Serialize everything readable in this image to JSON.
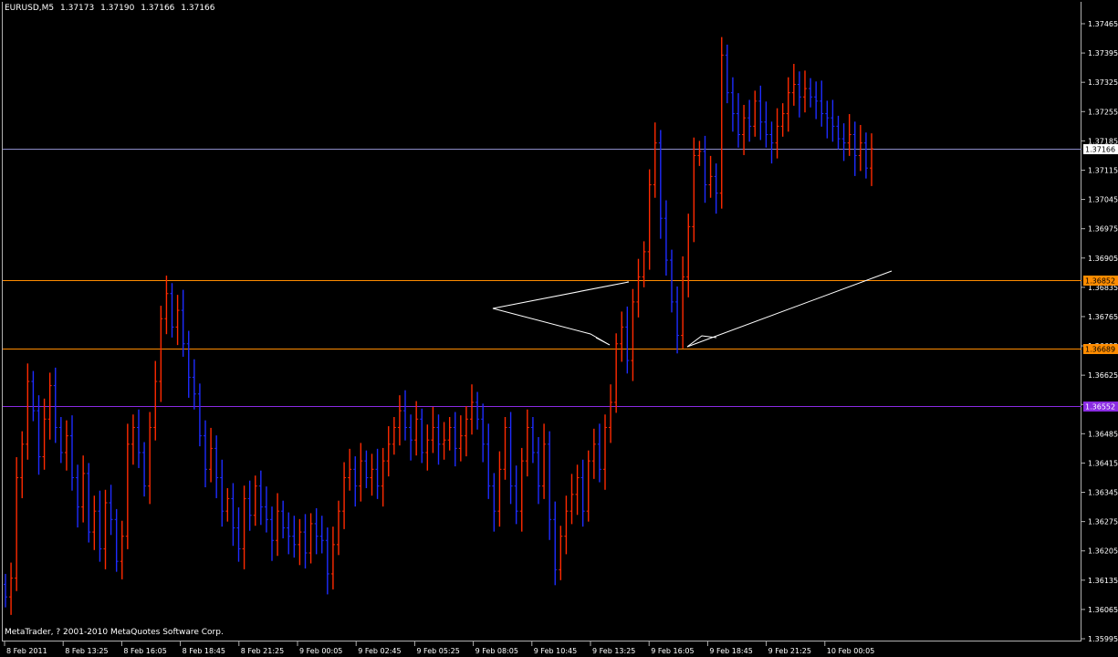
{
  "header": {
    "symbol": "EURUSD,M5",
    "open": "1.37173",
    "high": "1.37190",
    "low": "1.37166",
    "close": "1.37166"
  },
  "footer": {
    "copyright": "MetaTrader, ? 2001-2010 MetaQuotes Software Corp."
  },
  "colors": {
    "background": "#000000",
    "bull": "#ff2a00",
    "bear": "#1e2cff",
    "bid_line": "#8c8cc8",
    "orange_level": "#ff8c00",
    "purple_level": "#8a2be2",
    "drawing": "#ffffff",
    "axis_text": "#ffffff"
  },
  "chart_data": {
    "type": "candlestick",
    "y_ticks": [
      "1.37465",
      "1.37395",
      "1.37325",
      "1.37255",
      "1.37185",
      "1.37115",
      "1.37045",
      "1.36975",
      "1.36905",
      "1.36835",
      "1.36765",
      "1.36695",
      "1.36625",
      "1.36555",
      "1.36485",
      "1.36415",
      "1.36345",
      "1.36275",
      "1.36205",
      "1.36135",
      "1.36065",
      "1.35995"
    ],
    "ylim": [
      1.35995,
      1.37465
    ],
    "x_ticks": [
      "8 Feb 2011",
      "8 Feb 13:25",
      "8 Feb 16:05",
      "8 Feb 18:45",
      "8 Feb 21:25",
      "9 Feb 00:05",
      "9 Feb 02:45",
      "9 Feb 05:25",
      "9 Feb 08:05",
      "9 Feb 10:45",
      "9 Feb 13:25",
      "9 Feb 16:05",
      "9 Feb 18:45",
      "9 Feb 21:25",
      "10 Feb 00:05"
    ],
    "levels": [
      {
        "name": "bid",
        "price": 1.37166,
        "label": "1.37166",
        "color": "#8c8cc8",
        "tag_bg": "#ffffff",
        "tag_fg": "#000000"
      },
      {
        "name": "resistance",
        "price": 1.36852,
        "label": "1.36852",
        "color": "#ff8c00",
        "tag_bg": "#ff8c00",
        "tag_fg": "#000000"
      },
      {
        "name": "support",
        "price": 1.36689,
        "label": "1.36689",
        "color": "#ff8c00",
        "tag_bg": "#ff8c00",
        "tag_fg": "#000000"
      },
      {
        "name": "lower",
        "price": 1.36552,
        "label": "1.36552",
        "color": "#8a2be2",
        "tag_bg": "#8a2be2",
        "tag_fg": "#ffffff"
      }
    ],
    "closes": [
      1.36095,
      1.3614,
      1.3638,
      1.3646,
      1.3661,
      1.3654,
      1.3643,
      1.3652,
      1.366,
      1.365,
      1.3644,
      1.3648,
      1.3638,
      1.3631,
      1.3639,
      1.3625,
      1.363,
      1.3621,
      1.3632,
      1.3628,
      1.3618,
      1.3624,
      1.3646,
      1.365,
      1.3644,
      1.3636,
      1.365,
      1.3661,
      1.3676,
      1.3682,
      1.3674,
      1.3678,
      1.367,
      1.3662,
      1.3658,
      1.3648,
      1.364,
      1.3645,
      1.3638,
      1.363,
      1.3633,
      1.3626,
      1.3621,
      1.3633,
      1.3629,
      1.3636,
      1.3631,
      1.3628,
      1.3623,
      1.363,
      1.3626,
      1.3624,
      1.3622,
      1.3625,
      1.362,
      1.3627,
      1.3624,
      1.3623,
      1.3615,
      1.3622,
      1.363,
      1.3638,
      1.364,
      1.3636,
      1.3642,
      1.3638,
      1.364,
      1.3636,
      1.3642,
      1.3646,
      1.365,
      1.3654,
      1.365,
      1.3647,
      1.3652,
      1.3644,
      1.3647,
      1.365,
      1.3646,
      1.3647,
      1.365,
      1.3645,
      1.3648,
      1.3652,
      1.3656,
      1.3652,
      1.3646,
      1.3636,
      1.363,
      1.364,
      1.365,
      1.3636,
      1.363,
      1.3642,
      1.365,
      1.3644,
      1.3636,
      1.3646,
      1.3628,
      1.3616,
      1.3624,
      1.363,
      1.3634,
      1.3638,
      1.363,
      1.3642,
      1.3646,
      1.364,
      1.365,
      1.3656,
      1.367,
      1.3674,
      1.3666,
      1.368,
      1.3686,
      1.3692,
      1.3708,
      1.3718,
      1.37,
      1.369,
      1.368,
      1.3672,
      1.3686,
      1.3698,
      1.3715,
      1.3716,
      1.3708,
      1.371,
      1.3706,
      1.3739,
      1.373,
      1.3725,
      1.372,
      1.3724,
      1.3722,
      1.3728,
      1.3723,
      1.372,
      1.3718,
      1.3722,
      1.3725,
      1.373,
      1.3732,
      1.3729,
      1.3731,
      1.3729,
      1.3728,
      1.3725,
      1.3724,
      1.3722,
      1.3719,
      1.3718,
      1.372,
      1.3715,
      1.3718,
      1.3712,
      1.37166
    ],
    "annotations": [
      {
        "type": "polyline",
        "points": [
          [
            540,
            338
          ],
          [
            689,
            309
          ],
          [
            668,
            313
          ],
          [
            540,
            338
          ],
          [
            647,
            366
          ],
          [
            668,
            378
          ],
          [
            653,
            370
          ]
        ]
      },
      {
        "type": "polyline",
        "points": [
          [
            753,
            380
          ],
          [
            977,
            297
          ]
        ]
      },
      {
        "type": "polyline",
        "points": [
          [
            753,
            380
          ],
          [
            769,
            368
          ],
          [
            785,
            370
          ]
        ]
      }
    ]
  }
}
